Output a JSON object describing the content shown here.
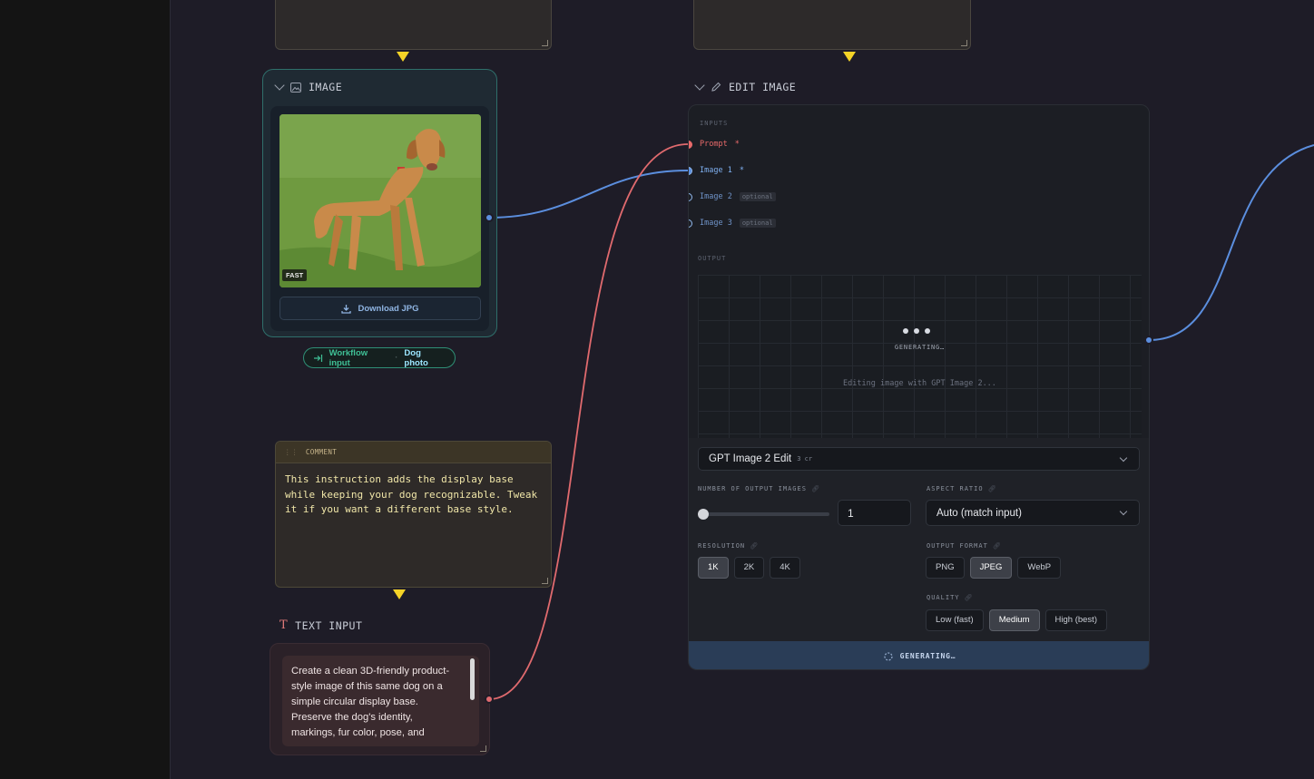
{
  "image_node": {
    "title": "IMAGE",
    "badge": "FAST",
    "download_label": "Download JPG",
    "workflow_input_label": "Workflow input",
    "workflow_input_value": "Dog photo"
  },
  "comment": {
    "title": "COMMENT",
    "text": "This instruction adds the display base while keeping your dog recognizable. Tweak it if you want a different base style."
  },
  "text_input": {
    "title": "TEXT INPUT",
    "text": "Create a clean 3D-friendly product-style image of this same dog on a simple circular display base. Preserve the dog's identity, markings, fur color, pose, and"
  },
  "edit_image": {
    "title": "EDIT IMAGE",
    "inputs_label": "INPUTS",
    "inputs": [
      {
        "label": "Prompt",
        "suffix": "*",
        "color": "#e86a6a"
      },
      {
        "label": "Image 1",
        "suffix": "*",
        "color": "#7fb0f0"
      },
      {
        "label": "Image 2",
        "suffix": "optional",
        "color": "#7fb0f0"
      },
      {
        "label": "Image 3",
        "suffix": "optional",
        "color": "#7fb0f0"
      }
    ],
    "output_label": "OUTPUT",
    "generating_small": "GENERATING…",
    "status_text": "Editing image with GPT Image 2...",
    "model": "GPT Image 2 Edit",
    "model_cost": "3 cr",
    "num_outputs_label": "NUMBER OF OUTPUT IMAGES",
    "num_outputs_value": "1",
    "num_outputs_slider_fraction": 0,
    "aspect_ratio_label": "ASPECT RATIO",
    "aspect_ratio_value": "Auto (match input)",
    "resolution_label": "RESOLUTION",
    "resolution_options": [
      "1K",
      "2K",
      "4K"
    ],
    "resolution_selected": "1K",
    "output_format_label": "OUTPUT FORMAT",
    "output_format_options": [
      "PNG",
      "JPEG",
      "WebP"
    ],
    "output_format_selected": "JPEG",
    "quality_label": "QUALITY",
    "quality_options": [
      "Low (fast)",
      "Medium",
      "High (best)"
    ],
    "quality_selected": "Medium",
    "generate_button": "GENERATING…"
  },
  "colors": {
    "image_wire": "#5b8ede",
    "text_wire": "#e06a6e",
    "flow_arrow": "#f5d327",
    "accent_teal": "#2f8f76"
  }
}
